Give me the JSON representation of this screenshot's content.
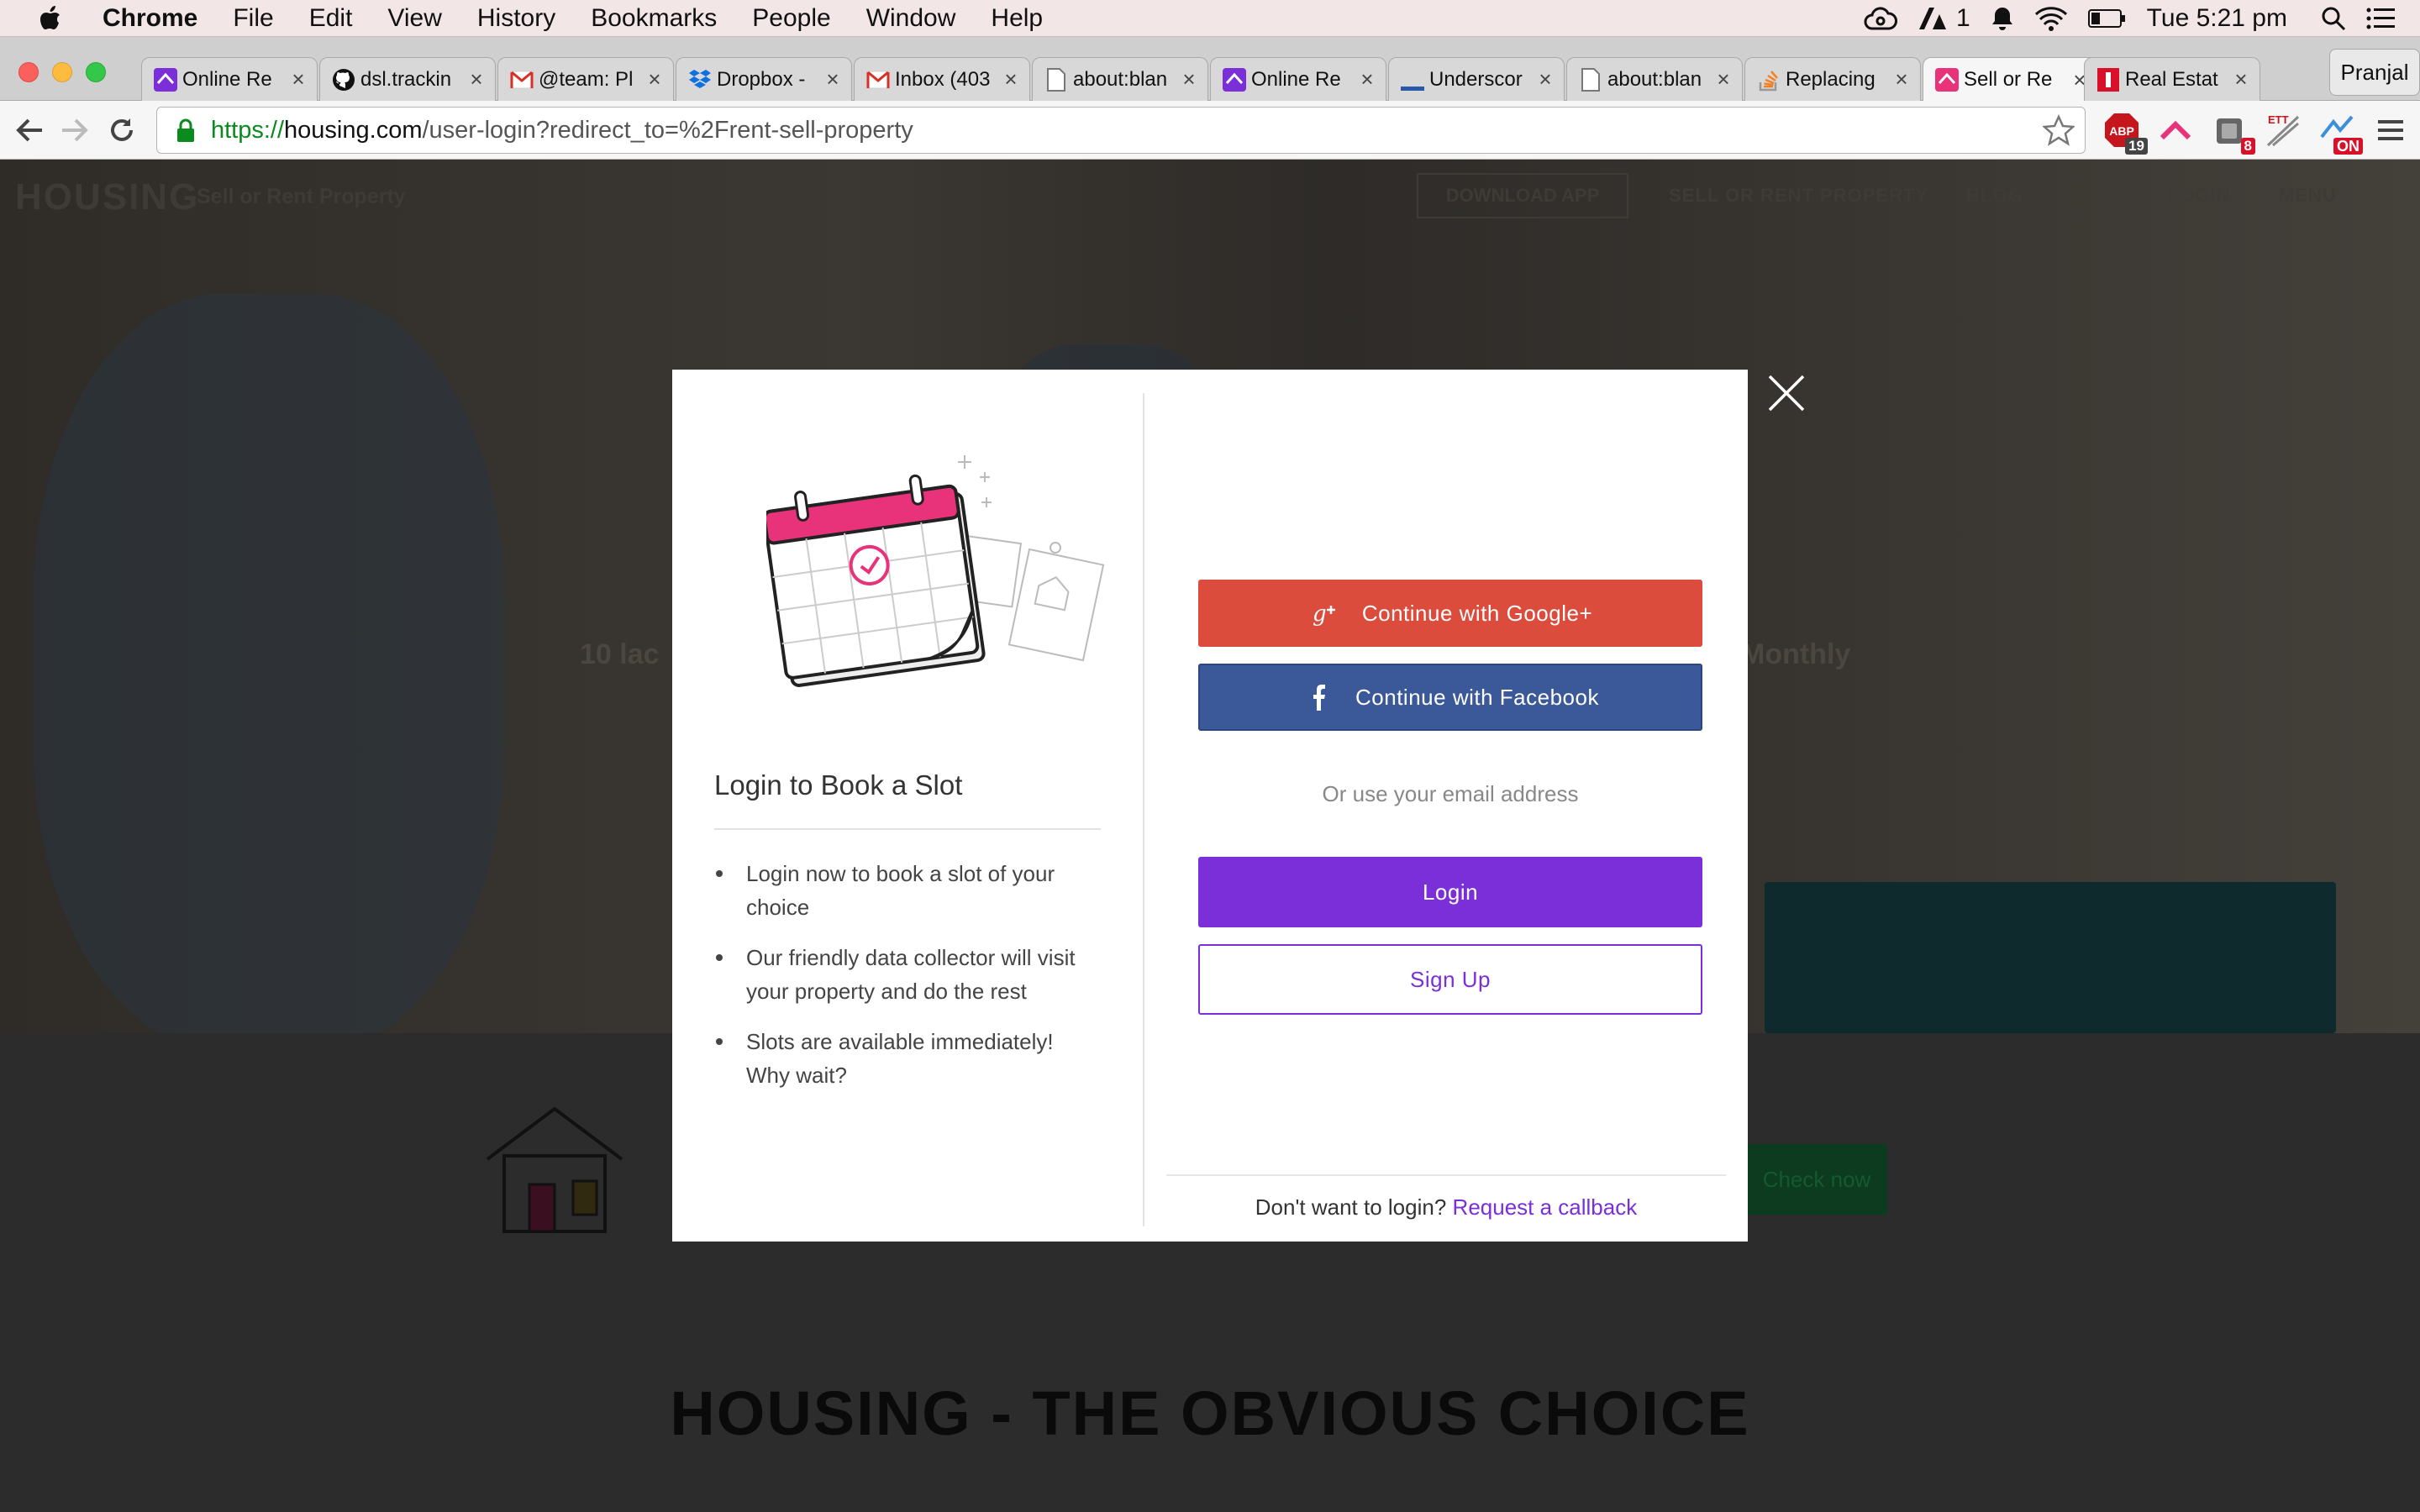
{
  "menubar": {
    "app": "Chrome",
    "items": [
      "File",
      "Edit",
      "View",
      "History",
      "Bookmarks",
      "People",
      "Window",
      "Help"
    ],
    "adobe_count": "1",
    "clock": "Tue 5:21 pm"
  },
  "tabs": [
    {
      "label": "Online Re",
      "icon": "housing-icon"
    },
    {
      "label": "dsl.trackin",
      "icon": "github-icon"
    },
    {
      "label": "@team: Pl",
      "icon": "gmail-icon"
    },
    {
      "label": "Dropbox -",
      "icon": "dropbox-icon"
    },
    {
      "label": "Inbox (403",
      "icon": "gmail-icon"
    },
    {
      "label": "about:blan",
      "icon": "page-icon"
    },
    {
      "label": "Online Re",
      "icon": "housing-icon"
    },
    {
      "label": "Underscor",
      "icon": "underscore-icon"
    },
    {
      "label": "about:blan",
      "icon": "page-icon"
    },
    {
      "label": "Replacing",
      "icon": "stackoverflow-icon"
    },
    {
      "label": "Sell or Re",
      "icon": "housing-icon",
      "active": true
    },
    {
      "label": "Real Estat",
      "icon": "realestate-icon"
    }
  ],
  "profile": "Pranjal",
  "address": {
    "scheme": "https://",
    "host": "housing.com",
    "path": "/user-login?redirect_to=%2Frent-sell-property"
  },
  "extensions": {
    "abp_badge": "19",
    "ext_badge": "8",
    "on_badge": "ON",
    "ett_label": "ETT"
  },
  "site": {
    "logo": "HOUSING",
    "subtitle": "Sell or Rent Property",
    "download_app": "DOWNLOAD APP",
    "nav": [
      "SELL OR RENT PROPERTY",
      "BLOG",
      "LOGIN",
      "MENU"
    ],
    "hero_left": "10 lac",
    "hero_right": "Monthly",
    "cta": "Check now",
    "big_title": "HOUSING - THE OBVIOUS CHOICE"
  },
  "modal": {
    "title": "Login to Book a Slot",
    "bullets": [
      "Login now to book a slot of your choice",
      "Our friendly data collector will visit your property and do the rest",
      "Slots are available immediately! Why wait?"
    ],
    "google_label": "Continue with Google+",
    "facebook_label": "Continue with Facebook",
    "or_email": "Or use your email address",
    "login_label": "Login",
    "signup_label": "Sign Up",
    "callback_prefix": "Don't want to login?",
    "callback_link": "Request a callback"
  },
  "colors": {
    "google": "#db4c3c",
    "facebook": "#3b5998",
    "accent": "#7a2fd8",
    "calendar_pink": "#e8337a"
  }
}
